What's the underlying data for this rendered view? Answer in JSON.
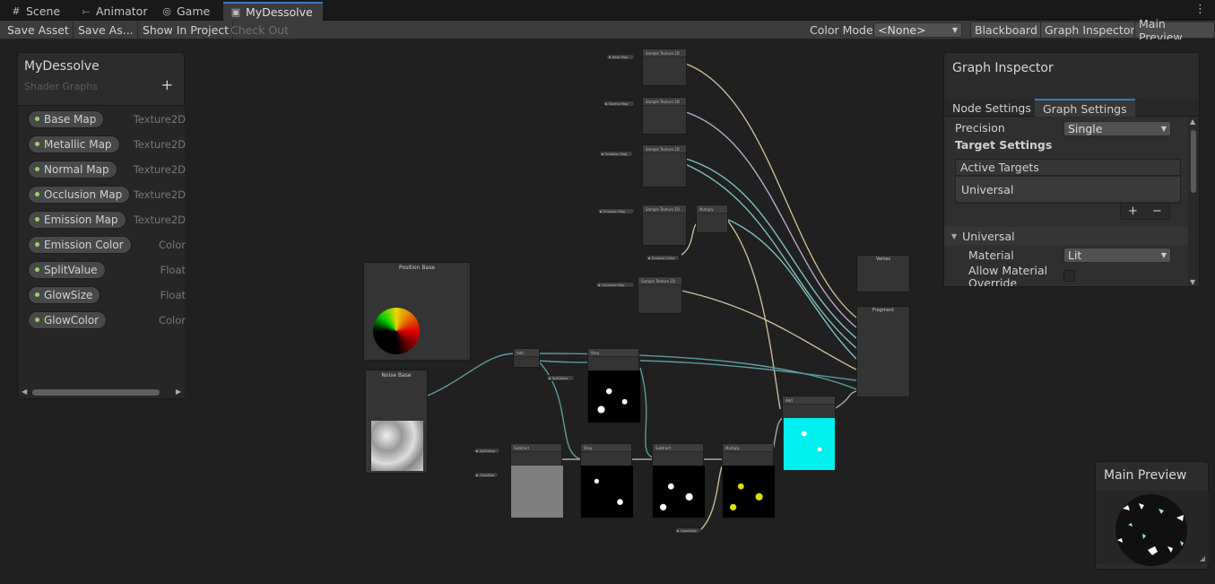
{
  "tabs": [
    {
      "label": "Scene",
      "icon": "grid-icon"
    },
    {
      "label": "Animator",
      "icon": "animator-icon"
    },
    {
      "label": "Game",
      "icon": "gamepad-icon"
    },
    {
      "label": "MyDessolve",
      "icon": "shader-graph-icon",
      "active": true
    }
  ],
  "toolbar": {
    "save_asset": "Save Asset",
    "save_as": "Save As...",
    "show_in_project": "Show In Project",
    "check_out": "Check Out",
    "color_mode_label": "Color Mode",
    "color_mode_value": "<None>",
    "blackboard": "Blackboard",
    "graph_inspector": "Graph Inspector",
    "main_preview": "Main Preview"
  },
  "blackboard": {
    "title": "MyDessolve",
    "subtitle": "Shader Graphs",
    "properties": [
      {
        "name": "Base Map",
        "type": "Texture2D"
      },
      {
        "name": "Metallic Map",
        "type": "Texture2D"
      },
      {
        "name": "Normal Map",
        "type": "Texture2D"
      },
      {
        "name": "Occlusion Map",
        "type": "Texture2D"
      },
      {
        "name": "Emission Map",
        "type": "Texture2D"
      },
      {
        "name": "Emission Color",
        "type": "Color"
      },
      {
        "name": "SplitValue",
        "type": "Float"
      },
      {
        "name": "GlowSize",
        "type": "Float"
      },
      {
        "name": "GlowColor",
        "type": "Color"
      }
    ]
  },
  "inspector": {
    "title": "Graph Inspector",
    "tab_node": "Node Settings",
    "tab_graph": "Graph Settings",
    "precision_label": "Precision",
    "precision_value": "Single",
    "target_settings": "Target Settings",
    "active_targets": "Active Targets",
    "target_item": "Universal",
    "section": "Universal",
    "material_label": "Material",
    "material_value": "Lit",
    "allow_override_line1": "Allow Material",
    "allow_override_line2": "Override"
  },
  "main_preview": {
    "title": "Main Preview"
  },
  "graph": {
    "position_node": "Position Base",
    "noise_node": "Noise Base",
    "vertex_node": "Vertex",
    "fragment_node": "Fragment"
  },
  "colors": {
    "accent": "#3a79bb",
    "property_dot": "#93d36a",
    "cyan_preview": "#00f0f0",
    "yellow_noise": "#e0e000"
  }
}
